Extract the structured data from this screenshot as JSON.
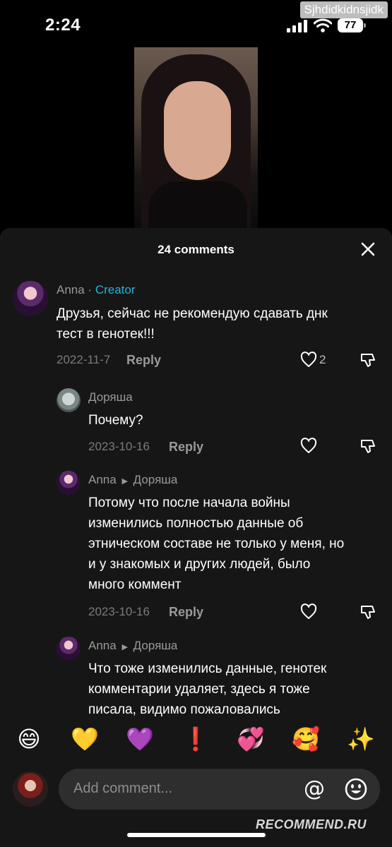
{
  "status_bar": {
    "time": "2:24",
    "battery": "77",
    "watermark": "Sjhdidkidnsjidk"
  },
  "sheet": {
    "title": "24 comments"
  },
  "comments": [
    {
      "author": "Anna",
      "badge_sep": " · ",
      "badge": "Creator",
      "text_lines": [
        "Друзья, сейчас не рекомендую сдавать днк",
        "тест в генотек!!!"
      ],
      "date": "2022-11-7",
      "reply": "Reply",
      "likes": "2"
    },
    {
      "author": "Доряша",
      "text_lines": [
        "Почему?"
      ],
      "date": "2023-10-16",
      "reply": "Reply"
    },
    {
      "author": "Anna",
      "reply_to": "Доряша",
      "text_lines": [
        "Потому что после начала войны",
        "изменились полностью данные об",
        "этническом составе не только у меня, но",
        "и у знакомых и других людей, было",
        "много коммент"
      ],
      "date": "2023-10-16",
      "reply": "Reply"
    },
    {
      "author": "Anna",
      "reply_to": "Доряша",
      "text_lines": [
        "Что тоже изменились данные, генотек",
        "комментарии удаляет, здесь я тоже",
        "писала, видимо пожаловались"
      ]
    }
  ],
  "emojis": [
    "😄",
    "💛",
    "💜",
    "❗",
    "💞",
    "🥰",
    "✨"
  ],
  "input": {
    "placeholder": "Add comment..."
  },
  "footer_logo": "RECOMMEND.RU",
  "colors": {
    "creator": "#27b3d6",
    "sheet_bg": "#161616"
  }
}
